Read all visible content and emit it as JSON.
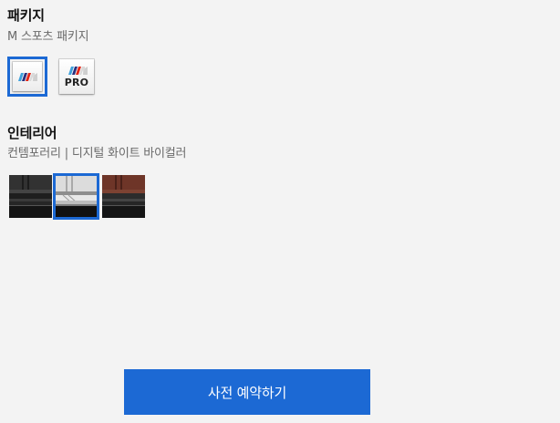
{
  "package": {
    "title": "패키지",
    "selected_name": "M 스포츠 패키지",
    "options": [
      {
        "name": "m-sport-package",
        "icon": "m-logo-icon",
        "selected": true
      },
      {
        "name": "m-sport-package-pro",
        "icon": "m-logo-pro-icon",
        "badge": "PRO",
        "selected": false
      }
    ]
  },
  "interior": {
    "title": "인테리어",
    "selected_name": "컨템포러리 | 디지털 화이트 바이컬러",
    "options": [
      {
        "name": "black",
        "color": "#2b2b2b",
        "selected": false
      },
      {
        "name": "digital-white-bicolor",
        "color": "#d9d9d9",
        "selected": true
      },
      {
        "name": "brown",
        "color": "#6e3528",
        "selected": false
      }
    ]
  },
  "cta": {
    "label": "사전 예약하기"
  },
  "colors": {
    "accent": "#1c69d4",
    "background": "#f3f3f3",
    "m_light_blue": "#3ea1dc",
    "m_dark_blue": "#2a2f7c",
    "m_red": "#e22718"
  }
}
